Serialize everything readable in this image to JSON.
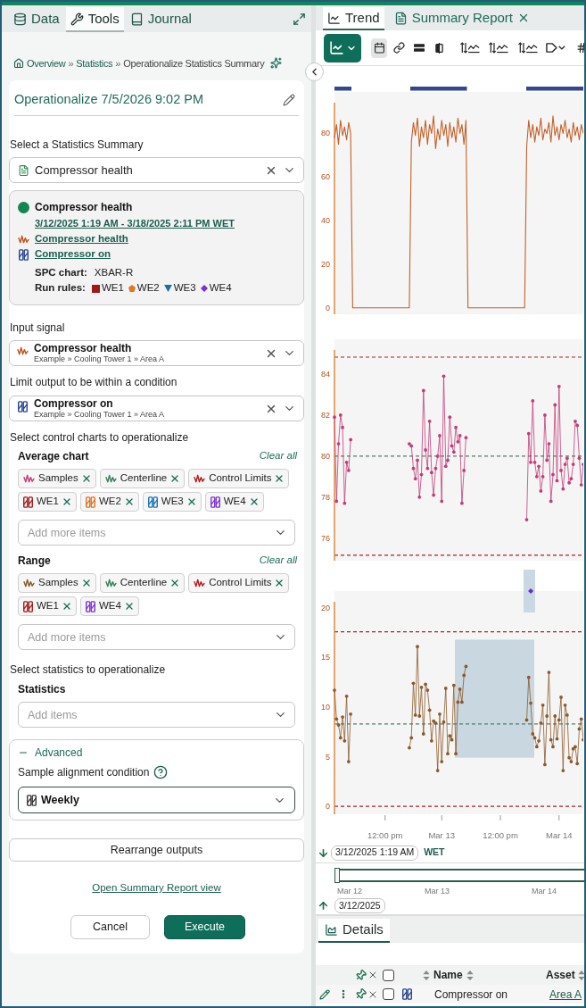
{
  "left_panel": {
    "tabs": [
      {
        "label": "Data",
        "selected": false
      },
      {
        "label": "Tools",
        "selected": true
      },
      {
        "label": "Journal",
        "selected": false
      }
    ],
    "breadcrumb": {
      "items": [
        "Overview",
        "Statistics",
        "Operationalize Statistics Summary"
      ],
      "separators": [
        "»",
        "»"
      ]
    },
    "title": "Operationalize 7/5/2026 9:02 PM",
    "statistics_summary": {
      "label": "Select a Statistics Summary",
      "value": "Compressor health"
    },
    "summary_card": {
      "name": "Compressor health",
      "date_range": "3/12/2025 1:19 AM - 3/18/2025 2:11 PM WET",
      "links": [
        {
          "kind": "signal",
          "label": "Compressor health"
        },
        {
          "kind": "condition",
          "label": "Compressor on"
        }
      ],
      "spc_chart_label": "SPC chart:",
      "spc_chart": "XBAR-R",
      "run_rules_label": "Run rules:",
      "run_rules": [
        {
          "kind": "square",
          "label": "WE1",
          "color": "#a3161a"
        },
        {
          "kind": "pentagon",
          "label": "WE2",
          "color": "#e0782a"
        },
        {
          "kind": "triangle",
          "label": "WE3",
          "color": "#1d6e9a"
        },
        {
          "kind": "diamond",
          "label": "WE4",
          "color": "#7a2fd2"
        }
      ]
    },
    "input_signal": {
      "label": "Input signal",
      "value": "Compressor health",
      "path": "Example » Cooling Tower 1 » Area A"
    },
    "limit_condition": {
      "label": "Limit output to be within a condition",
      "value": "Compressor on",
      "path": "Example » Cooling Tower 1 » Area A"
    },
    "control_charts": {
      "label": "Select control charts to operationalize",
      "groups": [
        {
          "title": "Average chart",
          "clear_label": "Clear all",
          "chips": [
            {
              "kind": "signal",
              "label": "Samples",
              "color": "#c23c78"
            },
            {
              "kind": "signal",
              "label": "Centerline",
              "color": "#3f7f5f"
            },
            {
              "kind": "signal",
              "label": "Control Limits",
              "color": "#b22222"
            },
            {
              "kind": "condition",
              "label": "WE1",
              "color": "#a3161a"
            },
            {
              "kind": "condition",
              "label": "WE2",
              "color": "#e0701e"
            },
            {
              "kind": "condition",
              "label": "WE3",
              "color": "#1a72b0"
            },
            {
              "kind": "condition",
              "label": "WE4",
              "color": "#7a2fd2"
            }
          ],
          "placeholder": "Add more items"
        },
        {
          "title": "Range",
          "clear_label": "Clear all",
          "chips": [
            {
              "kind": "signal",
              "label": "Samples",
              "color": "#8b5a2b"
            },
            {
              "kind": "signal",
              "label": "Centerline",
              "color": "#3f7f5f"
            },
            {
              "kind": "signal",
              "label": "Control Limits",
              "color": "#b22222"
            },
            {
              "kind": "condition",
              "label": "WE1",
              "color": "#a3161a"
            },
            {
              "kind": "condition",
              "label": "WE4",
              "color": "#7a2fd2"
            }
          ],
          "placeholder": "Add more items"
        }
      ]
    },
    "statistics": {
      "label": "Select statistics to operationalize",
      "title": "Statistics",
      "placeholder": "Add items"
    },
    "advanced": {
      "label": "Advanced",
      "expanded": true,
      "field_label": "Sample alignment condition",
      "value": "Weekly"
    },
    "rearrange_button": "Rearrange outputs",
    "report_link": "Open Summary Report view",
    "actions": [
      {
        "kind": "secondary",
        "label": "Cancel"
      },
      {
        "kind": "primary",
        "label": "Execute"
      }
    ]
  },
  "right_panel": {
    "tabs": [
      {
        "label": "Trend",
        "selected": true,
        "closable": false
      },
      {
        "label": "Summary Report",
        "selected": false,
        "closable": true
      }
    ],
    "toolbar": [
      {
        "selected": true
      },
      {
        "selected": false
      },
      {
        "selected": false
      },
      {
        "selected": false
      },
      {
        "selected": false
      },
      {
        "selected": false
      },
      {
        "selected": false
      },
      {
        "selected": false
      },
      {
        "selected": false
      }
    ],
    "charts": [
      {
        "chart_data": {
          "type": "line",
          "ylim": [
            -3,
            99
          ],
          "yticks": [
            0,
            20,
            40,
            60,
            80
          ],
          "categories": [
            null,
            null,
            null,
            null,
            null,
            null,
            null,
            null,
            null,
            null,
            null,
            null,
            null,
            null,
            null,
            null,
            null,
            null,
            null,
            null,
            null,
            null,
            null,
            null,
            null,
            null,
            null,
            null,
            null,
            null,
            null,
            null,
            null,
            null,
            null,
            null,
            null,
            null,
            null,
            null,
            null,
            null,
            null,
            null,
            null,
            null,
            null,
            null,
            null,
            null,
            null,
            null,
            null,
            null,
            null,
            null,
            null,
            null,
            null,
            null,
            null,
            null,
            null,
            null,
            null,
            null,
            null,
            null,
            null,
            null,
            null,
            null,
            null,
            null,
            null,
            null,
            null,
            null,
            null,
            null,
            null,
            null,
            null,
            null,
            null,
            null,
            null,
            null,
            null,
            null,
            null,
            null,
            null,
            null,
            null,
            null,
            null,
            null,
            null,
            null,
            null,
            null,
            null,
            null,
            null,
            null,
            null,
            null,
            null,
            null,
            null,
            null,
            null,
            null,
            null,
            null,
            null,
            null,
            null,
            null,
            null,
            null,
            null,
            null
          ],
          "series": [
            {
              "color": "#c0622a",
              "values": [
                78,
                84,
                75,
                86,
                79,
                83,
                77,
                85,
                80,
                0,
                0,
                0,
                0,
                0,
                0,
                0,
                0,
                0,
                0,
                0,
                0,
                0,
                0,
                0,
                0,
                0,
                0,
                0,
                0,
                0,
                0,
                0,
                0,
                0,
                0,
                0,
                0,
                0,
                76,
                85,
                79,
                87,
                74,
                83,
                78,
                86,
                75,
                84,
                80,
                88,
                73,
                82,
                77,
                86,
                79,
                84,
                74,
                85,
                78,
                83,
                76,
                87,
                80,
                84,
                75,
                86,
                0,
                0,
                0,
                0,
                0,
                0,
                0,
                0,
                0,
                0,
                0,
                0,
                0,
                0,
                0,
                0,
                0,
                0,
                0,
                0,
                0,
                0,
                0,
                0,
                0,
                0,
                0,
                0,
                0,
                74,
                86,
                78,
                84,
                76,
                83,
                79,
                87,
                77,
                82,
                80,
                85,
                76,
                88,
                79,
                83,
                77,
                84,
                80,
                86,
                78,
                82,
                76,
                85,
                79,
                83,
                77,
                84,
                80
              ]
            }
          ]
        }
      },
      {
        "chart_data": {
          "type": "line",
          "ylim": [
            74.9,
            85.7
          ],
          "yticks": [
            76,
            78,
            80,
            82,
            84
          ],
          "categories": [
            null,
            null,
            null,
            null,
            null,
            null,
            null,
            null,
            null,
            null,
            null,
            null,
            null,
            null,
            null,
            null,
            null,
            null,
            null,
            null,
            null,
            null,
            null,
            null,
            null,
            null,
            null,
            null,
            null,
            null,
            null,
            null,
            null,
            null,
            null,
            null,
            null,
            null,
            null,
            null,
            null,
            null,
            null,
            null,
            null,
            null,
            null,
            null,
            null,
            null,
            null,
            null,
            null,
            null,
            null,
            null,
            null,
            null,
            null,
            null,
            null,
            null,
            null,
            null,
            null,
            null,
            null,
            null,
            null,
            null,
            null,
            null,
            null,
            null,
            null,
            null,
            null,
            null,
            null,
            null,
            null,
            null,
            null,
            null,
            null,
            null,
            null,
            null,
            null,
            null,
            null,
            null,
            null,
            null,
            null,
            null,
            null,
            null,
            null,
            null,
            null,
            null,
            null,
            null,
            null,
            null,
            null,
            null,
            null,
            null,
            null,
            null,
            null,
            null,
            null,
            null,
            null,
            null,
            null,
            null,
            null,
            null,
            null,
            null
          ],
          "series": [
            {
              "color": "#c23c78",
              "values": [
                81.9,
                77.8,
                80.6,
                82.0,
                81.4,
                77.7,
                79.7,
                79.3,
                80.8,
                null,
                null,
                null,
                null,
                null,
                null,
                null,
                null,
                null,
                null,
                null,
                null,
                null,
                null,
                null,
                null,
                null,
                null,
                null,
                null,
                null,
                null,
                null,
                null,
                null,
                null,
                null,
                null,
                80.6,
                80.5,
                79.4,
                78.9,
                79.8,
                78.0,
                79.1,
                83.2,
                80.3,
                79.4,
                81.7,
                79.2,
                78.1,
                79.4,
                80.0,
                81.0,
                77.8,
                83.9,
                79.5,
                79.8,
                81.9,
                80.5,
                80.2,
                81.4,
                80.7,
                81.0,
                77.7,
                79.3,
                80.9,
                null,
                null,
                null,
                null,
                null,
                null,
                null,
                null,
                null,
                null,
                null,
                null,
                null,
                null,
                null,
                null,
                null,
                null,
                null,
                null,
                null,
                null,
                null,
                null,
                null,
                null,
                null,
                null,
                null,
                76.9,
                81.1,
                79.7,
                82.7,
                79.7,
                79.0,
                79.5,
                78.3,
                79.0,
                82.0,
                79.8,
                80.6,
                77.8,
                79.1,
                82.5,
                78.8,
                83.4,
                79.3,
                78.4,
                79.6,
                79.9,
                78.7,
                78.9,
                79.6,
                81.7,
                81.5,
                79.9,
                78.6,
                79.6
              ]
            }
          ],
          "ref_lines": [
            {
              "axis": "y",
              "value": 84.83,
              "color": "#a3262a"
            },
            {
              "axis": "y",
              "value": 80,
              "color": "#4f7f66"
            },
            {
              "axis": "y",
              "value": 75.17,
              "color": "#a3262a"
            }
          ]
        }
      },
      {
        "chart_data": {
          "type": "line",
          "ylim": [
            -0.8,
            21.7
          ],
          "yticks": [
            0,
            5,
            10,
            15,
            20
          ],
          "categories": [
            null,
            null,
            null,
            null,
            null,
            null,
            null,
            null,
            null,
            null,
            null,
            null,
            null,
            null,
            null,
            null,
            null,
            null,
            null,
            null,
            null,
            null,
            null,
            null,
            null,
            "12:00 pm",
            null,
            null,
            null,
            null,
            null,
            null,
            null,
            null,
            null,
            null,
            null,
            null,
            null,
            null,
            null,
            null,
            null,
            null,
            null,
            null,
            null,
            null,
            null,
            null,
            null,
            null,
            null,
            "Mar 13",
            null,
            null,
            null,
            null,
            null,
            null,
            null,
            null,
            null,
            null,
            null,
            null,
            null,
            null,
            null,
            null,
            null,
            null,
            null,
            null,
            null,
            null,
            null,
            null,
            null,
            null,
            null,
            null,
            "12:00 pm",
            null,
            null,
            null,
            null,
            null,
            null,
            null,
            null,
            null,
            null,
            null,
            null,
            null,
            null,
            null,
            null,
            null,
            null,
            null,
            null,
            null,
            null,
            null,
            null,
            null,
            null,
            null,
            null,
            "Mar 14",
            null,
            null,
            null,
            null,
            null,
            null,
            null,
            null,
            null,
            null,
            null,
            null
          ],
          "series": [
            {
              "color": "#8b5a2b",
              "values": [
                11.7,
                8.8,
                8.2,
                6.9,
                9.0,
                6.6,
                11.1,
                4.5,
                9.3,
                null,
                null,
                null,
                null,
                null,
                null,
                null,
                null,
                null,
                null,
                null,
                null,
                null,
                null,
                null,
                null,
                null,
                null,
                null,
                null,
                null,
                null,
                null,
                null,
                null,
                null,
                null,
                null,
                5.9,
                6.9,
                12.4,
                9.2,
                16.1,
                9.1,
                12.0,
                7.3,
                12.3,
                11.7,
                9.7,
                6.6,
                8.6,
                8.4,
                3.6,
                9.3,
                4.5,
                8.5,
                11.9,
                5.3,
                7.1,
                6.7,
                12.2,
                5.3,
                10.5,
                11.8,
                10.5,
                13.2,
                14.1,
                null,
                null,
                null,
                null,
                null,
                null,
                null,
                null,
                null,
                null,
                null,
                null,
                null,
                null,
                null,
                null,
                null,
                null,
                null,
                null,
                null,
                null,
                null,
                null,
                null,
                null,
                null,
                null,
                null,
                8.7,
                13.0,
                10.4,
                7.3,
                6.9,
                6.0,
                6.6,
                8.4,
                10.2,
                4.2,
                9.1,
                13.5,
                6.7,
                6.0,
                9.1,
                6.8,
                8.7,
                11.0,
                3.6,
                10.2,
                9.2,
                4.9,
                4.5,
                5.8,
                6.0,
                4.3,
                7.8,
                8.8,
                6.7
              ]
            }
          ],
          "ref_lines": [
            {
              "axis": "y",
              "value": 17.6,
              "color": "#a3262a"
            },
            {
              "axis": "y",
              "value": 8.3,
              "color": "#4f7f66"
            },
            {
              "axis": "y",
              "value": 0,
              "color": "#a3262a"
            }
          ]
        }
      }
    ],
    "start_time": {
      "value": "3/12/2025 1:19 AM",
      "timezone": "WET"
    },
    "navigator": {
      "ticks": [
        "Mar 12",
        "Mar 13",
        "Mar 14"
      ]
    },
    "display_date": "3/12/2025",
    "details": {
      "tab": "Details",
      "header_checked": false,
      "columns": [
        "Name",
        "Asset"
      ],
      "rows": [
        {
          "name": "Compressor on",
          "asset": "Area A",
          "checked": false
        }
      ]
    }
  }
}
